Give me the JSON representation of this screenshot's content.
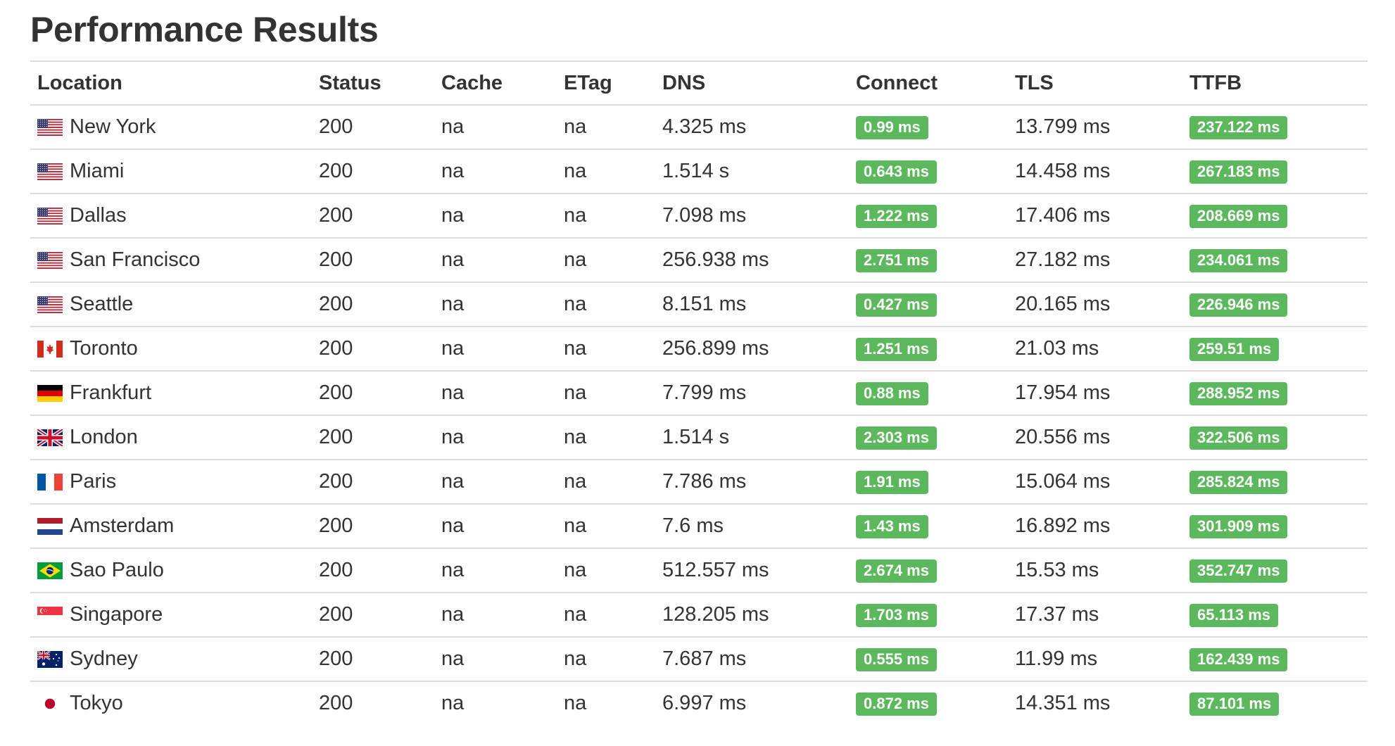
{
  "page": {
    "title": "Performance Results"
  },
  "colors": {
    "badge_green": "#5cb85c",
    "row_border": "#dddddd",
    "text": "#333333"
  },
  "table": {
    "headers": {
      "location": "Location",
      "status": "Status",
      "cache": "Cache",
      "etag": "ETag",
      "dns": "DNS",
      "connect": "Connect",
      "tls": "TLS",
      "ttfb": "TTFB"
    },
    "rows": [
      {
        "flag": "us",
        "location": "New York",
        "status": "200",
        "cache": "na",
        "etag": "na",
        "dns": "4.325 ms",
        "connect": "0.99 ms",
        "tls": "13.799 ms",
        "ttfb": "237.122 ms"
      },
      {
        "flag": "us",
        "location": "Miami",
        "status": "200",
        "cache": "na",
        "etag": "na",
        "dns": "1.514 s",
        "connect": "0.643 ms",
        "tls": "14.458 ms",
        "ttfb": "267.183 ms"
      },
      {
        "flag": "us",
        "location": "Dallas",
        "status": "200",
        "cache": "na",
        "etag": "na",
        "dns": "7.098 ms",
        "connect": "1.222 ms",
        "tls": "17.406 ms",
        "ttfb": "208.669 ms"
      },
      {
        "flag": "us",
        "location": "San Francisco",
        "status": "200",
        "cache": "na",
        "etag": "na",
        "dns": "256.938 ms",
        "connect": "2.751 ms",
        "tls": "27.182 ms",
        "ttfb": "234.061 ms"
      },
      {
        "flag": "us",
        "location": "Seattle",
        "status": "200",
        "cache": "na",
        "etag": "na",
        "dns": "8.151 ms",
        "connect": "0.427 ms",
        "tls": "20.165 ms",
        "ttfb": "226.946 ms"
      },
      {
        "flag": "ca",
        "location": "Toronto",
        "status": "200",
        "cache": "na",
        "etag": "na",
        "dns": "256.899 ms",
        "connect": "1.251 ms",
        "tls": "21.03 ms",
        "ttfb": "259.51 ms"
      },
      {
        "flag": "de",
        "location": "Frankfurt",
        "status": "200",
        "cache": "na",
        "etag": "na",
        "dns": "7.799 ms",
        "connect": "0.88 ms",
        "tls": "17.954 ms",
        "ttfb": "288.952 ms"
      },
      {
        "flag": "gb",
        "location": "London",
        "status": "200",
        "cache": "na",
        "etag": "na",
        "dns": "1.514 s",
        "connect": "2.303 ms",
        "tls": "20.556 ms",
        "ttfb": "322.506 ms"
      },
      {
        "flag": "fr",
        "location": "Paris",
        "status": "200",
        "cache": "na",
        "etag": "na",
        "dns": "7.786 ms",
        "connect": "1.91 ms",
        "tls": "15.064 ms",
        "ttfb": "285.824 ms"
      },
      {
        "flag": "nl",
        "location": "Amsterdam",
        "status": "200",
        "cache": "na",
        "etag": "na",
        "dns": "7.6 ms",
        "connect": "1.43 ms",
        "tls": "16.892 ms",
        "ttfb": "301.909 ms"
      },
      {
        "flag": "br",
        "location": "Sao Paulo",
        "status": "200",
        "cache": "na",
        "etag": "na",
        "dns": "512.557 ms",
        "connect": "2.674 ms",
        "tls": "15.53 ms",
        "ttfb": "352.747 ms"
      },
      {
        "flag": "sg",
        "location": "Singapore",
        "status": "200",
        "cache": "na",
        "etag": "na",
        "dns": "128.205 ms",
        "connect": "1.703 ms",
        "tls": "17.37 ms",
        "ttfb": "65.113 ms"
      },
      {
        "flag": "au",
        "location": "Sydney",
        "status": "200",
        "cache": "na",
        "etag": "na",
        "dns": "7.687 ms",
        "connect": "0.555 ms",
        "tls": "11.99 ms",
        "ttfb": "162.439 ms"
      },
      {
        "flag": "jp",
        "location": "Tokyo",
        "status": "200",
        "cache": "na",
        "etag": "na",
        "dns": "6.997 ms",
        "connect": "0.872 ms",
        "tls": "14.351 ms",
        "ttfb": "87.101 ms"
      }
    ]
  }
}
